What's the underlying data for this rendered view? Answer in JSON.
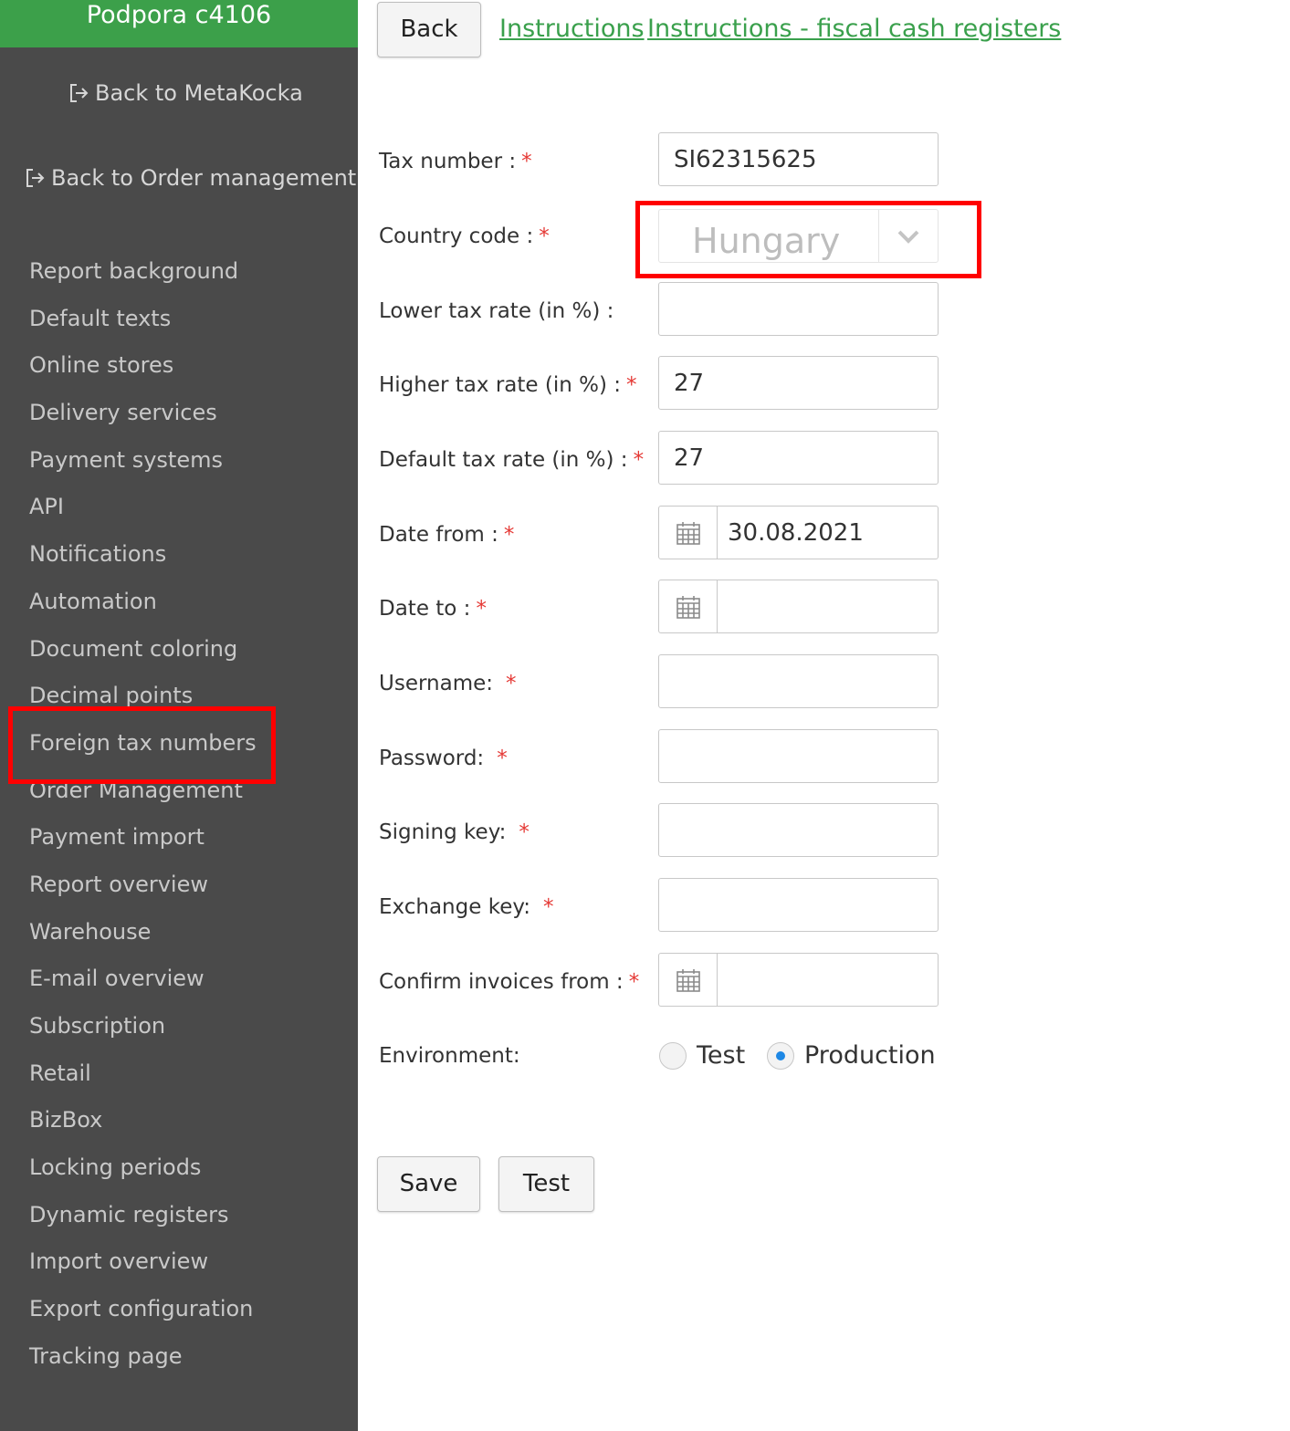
{
  "sidebar": {
    "company": "Podpora c4106",
    "back_metakocka": "Back to MetaKocka",
    "back_order_mgmt": "Back to Order management",
    "items": [
      {
        "label": "Report background"
      },
      {
        "label": "Default texts"
      },
      {
        "label": "Online stores"
      },
      {
        "label": "Delivery services"
      },
      {
        "label": "Payment systems"
      },
      {
        "label": "API"
      },
      {
        "label": "Notifications"
      },
      {
        "label": "Automation"
      },
      {
        "label": "Document coloring"
      },
      {
        "label": "Decimal points"
      },
      {
        "label": "Foreign tax numbers"
      },
      {
        "label": "Order Management"
      },
      {
        "label": "Payment import"
      },
      {
        "label": "Report overview"
      },
      {
        "label": "Warehouse"
      },
      {
        "label": "E-mail overview"
      },
      {
        "label": "Subscription"
      },
      {
        "label": "Retail"
      },
      {
        "label": "BizBox"
      },
      {
        "label": "Locking periods"
      },
      {
        "label": "Dynamic registers"
      },
      {
        "label": "Import overview"
      },
      {
        "label": "Export configuration"
      },
      {
        "label": "Tracking page"
      }
    ]
  },
  "topbar": {
    "back_label": "Back",
    "instructions": "Instructions",
    "instructions_fiscal": "Instructions - fiscal cash registers"
  },
  "form": {
    "tax_number": {
      "label": "Tax number :",
      "value": "SI62315625"
    },
    "country_code": {
      "label": "Country code :",
      "value": "Hungary"
    },
    "lower_tax_rate": {
      "label": "Lower tax rate (in %) :",
      "value": ""
    },
    "higher_tax_rate": {
      "label": "Higher tax rate (in %) :",
      "value": "27"
    },
    "default_tax_rate": {
      "label": "Default tax rate (in %) :",
      "value": "27"
    },
    "date_from": {
      "label": "Date from :",
      "value": "30.08.2021"
    },
    "date_to": {
      "label": "Date to :",
      "value": ""
    },
    "username": {
      "label": "Username:",
      "value": ""
    },
    "password": {
      "label": "Password:",
      "value": ""
    },
    "signing_key": {
      "label": "Signing key:",
      "value": ""
    },
    "exchange_key": {
      "label": "Exchange key:",
      "value": ""
    },
    "confirm_invoices_from": {
      "label": "Confirm invoices from :",
      "value": ""
    },
    "environment": {
      "label": "Environment:",
      "option_test": "Test",
      "option_production": "Production",
      "selected": "Production"
    },
    "required_mark": "*"
  },
  "actions": {
    "save_label": "Save",
    "test_label": "Test"
  },
  "colors": {
    "sidebar_bg": "#4a4a4a",
    "brand_green": "#3ca04a",
    "link_green": "#3aa04c",
    "highlight_red": "#ff0000",
    "required_red": "#e53935"
  }
}
